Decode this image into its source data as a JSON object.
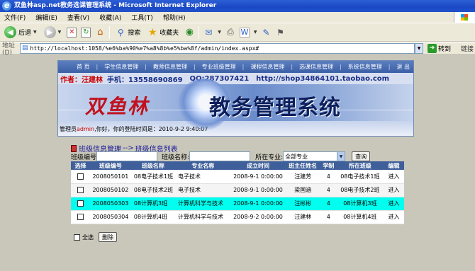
{
  "window": {
    "title": "双鱼林asp.net教务选课管理系统 - Microsoft Internet Explorer"
  },
  "menu": [
    "文件(F)",
    "编辑(E)",
    "查看(V)",
    "收藏(A)",
    "工具(T)",
    "帮助(H)"
  ],
  "toolbar": {
    "back": "后退",
    "search": "搜索",
    "favorites": "收藏夹"
  },
  "address": {
    "label": "地址(D)",
    "url": "http://localhost:1058/%e6%ba%90%e7%a8%8b%e5%ba%8f/admin/index.aspx#",
    "go": "转到",
    "links": "链接"
  },
  "banner": {
    "nav": [
      "首 页",
      "学生信息管理",
      "教师信息管理",
      "专业班级管理",
      "课程信息管理",
      "选课信息管理",
      "系统信息管理",
      "退 出"
    ],
    "author_label": "作者：汪建林",
    "phone": "手机：13558690869",
    "qq": "QQ:287307421",
    "url": "http://shop34864101.taobao.com",
    "brand": "双鱼林",
    "system_name": "教务管理系统",
    "welcome_prefix": "管理员",
    "welcome_user": "admin",
    "welcome_suffix": ",你好，你的登陆时间是：2010-9-2 9:40:07"
  },
  "breadcrumb": {
    "root": "班级信息管理",
    "arrow": "-->",
    "current": "班级信息列表"
  },
  "search": {
    "class_no_label": "班级编号",
    "class_name_label": "班级名称:",
    "major_label": "所在专业:",
    "major_value": "全部专业",
    "query_button": "查询"
  },
  "table": {
    "headers": [
      "选择",
      "班级编号",
      "班级名称",
      "专业名称",
      "成立时间",
      "班主任姓名",
      "学制",
      "所在班级",
      "编辑"
    ],
    "rows": [
      [
        "",
        "2008050101",
        "08电子技术1班",
        "电子技术",
        "2008-9-1 0:00:00",
        "汪建芳",
        "4",
        "08电子技术1班",
        "进入"
      ],
      [
        "",
        "2008050102",
        "08电子技术2班",
        "电子技术",
        "2008-9-1 0:00:00",
        "梁国涵",
        "4",
        "08电子技术2班",
        "进入"
      ],
      [
        "",
        "2008050303",
        "08计算机3班",
        "计算机科学与技术",
        "2008-9-1 0:00:00",
        "汪彬彬",
        "4",
        "08计算机3班",
        "进入"
      ],
      [
        "",
        "2008050304",
        "08计算机4班",
        "计算机科学与技术",
        "2008-9-2 0:00:00",
        "汪建林",
        "4",
        "08计算机4班",
        "进入"
      ]
    ]
  },
  "footer": {
    "select_all": "全选",
    "delete_button": "删除"
  }
}
